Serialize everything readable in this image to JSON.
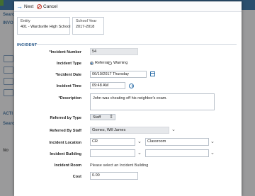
{
  "background": {
    "left_labels": [
      "Searc",
      "INVO",
      "ACTI",
      "Searc",
      "No"
    ]
  },
  "toolbar": {
    "next_label": "Next",
    "cancel_label": "Cancel"
  },
  "context": {
    "entity_label": "Entity",
    "entity_value": "401 - Wardsville High School",
    "year_label": "School Year",
    "year_value": "2017-2018"
  },
  "section": {
    "title": "INCIDENT"
  },
  "form": {
    "incident_number_label": "*Incident Number",
    "incident_number_value": "54",
    "incident_type_label": "Incident Type",
    "type_referral": "Referral",
    "type_warning": "Warning",
    "incident_date_label": "*Incident Date",
    "incident_date_value": "06/10/2017 Thursday",
    "incident_time_label": "Incident Time",
    "incident_time_value": "09:48 AM",
    "description_label": "*Description",
    "description_value": "John was cheating off his neighbor's exam.",
    "referred_by_type_label": "Referred by Type",
    "referred_by_type_value": "Staff",
    "referred_by_staff_label": "Referred By Staff",
    "referred_by_staff_value": "Gomez, Will James",
    "location_label": "Incident Location",
    "location_value_1": "CR",
    "location_value_2": "Classroom",
    "building_label": "Incident Building",
    "building_value_1": "",
    "building_value_2": "",
    "room_label": "Incident Room",
    "room_hint": "Please select an Incident Building",
    "cost_label": "Cost",
    "cost_value": "0.00"
  }
}
